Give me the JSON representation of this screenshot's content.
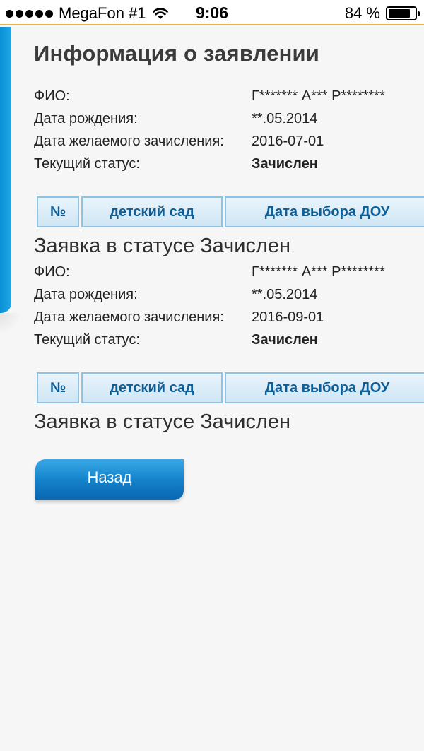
{
  "status_bar": {
    "carrier": "MegaFon #1",
    "time": "9:06",
    "battery": "84 %",
    "battery_level": 0.84
  },
  "page": {
    "title": "Информация о заявлении"
  },
  "labels": {
    "fio": "ФИО:",
    "birth_date": "Дата рождения:",
    "desired_date": "Дата желаемого зачисления:",
    "current_status": "Текущий статус:"
  },
  "table_headers": {
    "num": "№",
    "kindergarten": "детский сад",
    "selection_date": "Дата выбора ДОУ"
  },
  "applications": [
    {
      "fio": "Г******* А*** Р********",
      "birth_date": "**.05.2014",
      "desired_date": "2016-07-01",
      "status": "Зачислен",
      "status_heading": "Заявка в статусе Зачислен"
    },
    {
      "fio": "Г******* А*** Р********",
      "birth_date": "**.05.2014",
      "desired_date": "2016-09-01",
      "status": "Зачислен",
      "status_heading": "Заявка в статусе Зачислен"
    }
  ],
  "buttons": {
    "back": "Назад"
  },
  "colors": {
    "accent": "#1483cb",
    "table_header_text": "#0e5f97",
    "status_bar_line": "#e8b24c"
  }
}
